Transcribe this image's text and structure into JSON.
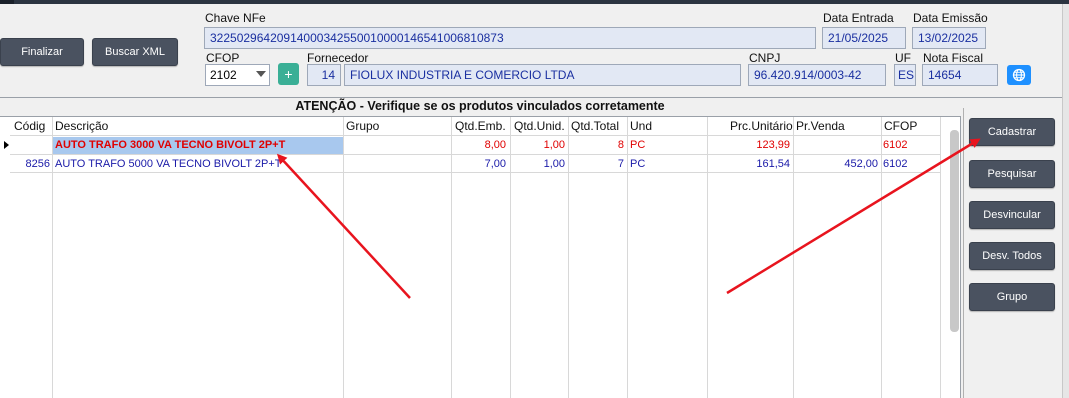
{
  "toolbar": {
    "finalizar_label": "Finalizar",
    "buscar_xml_label": "Buscar XML"
  },
  "header": {
    "chave_label": "Chave NFe",
    "chave_value": "32250296420914000342550010000146541006810873",
    "data_entrada_label": "Data Entrada",
    "data_entrada_value": "21/05/2025",
    "data_emissao_label": "Data Emissão",
    "data_emissao_value": "13/02/2025",
    "cfop_label": "CFOP",
    "cfop_value": "2102",
    "plus_label": "+",
    "fornecedor_label": "Fornecedor",
    "fornecedor_code": "14",
    "fornecedor_name": "FIOLUX INDUSTRIA E COMERCIO LTDA",
    "cnpj_label": "CNPJ",
    "cnpj_value": "96.420.914/0003-42",
    "uf_label": "UF",
    "uf_value": "ES",
    "nota_label": "Nota Fiscal",
    "nota_value": "14654"
  },
  "warning": "ATENÇÃO - Verifique se os produtos  vinculados corretamente",
  "grid": {
    "columns": {
      "codigo": "Códig",
      "descricao": "Descrição",
      "grupo": "Grupo",
      "qtd_emb": "Qtd.Emb.",
      "qtd_unid": "Qtd.Unid.",
      "qtd_total": "Qtd.Total",
      "und": "Und",
      "prc_unitario": "Prc.Unitário",
      "pr_venda": "Pr.Venda",
      "cfop": "CFOP"
    },
    "rows": [
      {
        "codigo": "",
        "descricao": "AUTO TRAFO 3000 VA TECNO BIVOLT 2P+T",
        "grupo": "",
        "qtd_emb": "8,00",
        "qtd_unid": "1,00",
        "qtd_total": "8",
        "und": "PC",
        "prc_unitario": "123,99",
        "pr_venda": "",
        "cfop": "6102"
      },
      {
        "codigo": "8256",
        "descricao": "AUTO TRAFO 5000 VA TECNO BIVOLT 2P+T",
        "grupo": "",
        "qtd_emb": "7,00",
        "qtd_unid": "1,00",
        "qtd_total": "7",
        "und": "PC",
        "prc_unitario": "161,54",
        "pr_venda": "452,00",
        "cfop": "6102"
      }
    ]
  },
  "side_buttons": {
    "cadastrar": "Cadastrar",
    "pesquisar": "Pesquisar",
    "desvincular": "Desvincular",
    "desv_todos": "Desv. Todos",
    "grupo": "Grupo"
  },
  "colors": {
    "accent_red": "#e00000",
    "text_blue": "#1a1aa8",
    "selection": "#a8c8ee",
    "button_dark": "#4a5260",
    "plus_green": "#3aaf96",
    "globe_blue": "#1e90ff"
  },
  "icons": [
    "plus-icon",
    "globe-icon",
    "row-pointer-icon",
    "annotation-arrow"
  ]
}
